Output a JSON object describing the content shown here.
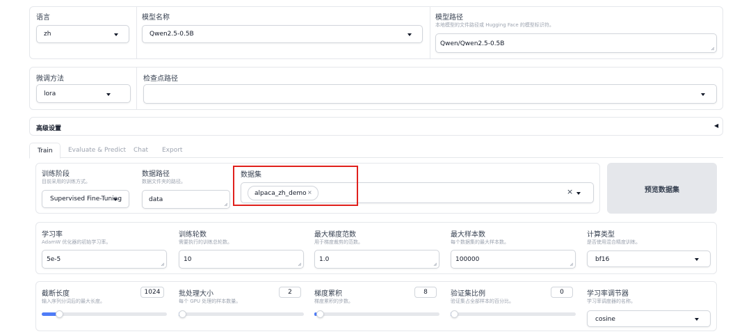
{
  "top": {
    "language": {
      "label": "语言",
      "value": "zh"
    },
    "model_name": {
      "label": "模型名称",
      "value": "Qwen2.5-0.5B"
    },
    "model_path": {
      "label": "模型路径",
      "hint": "本地模型的文件路径或 Hugging Face 的模型标识符。",
      "value": "Qwen/Qwen2.5-0.5B"
    }
  },
  "second": {
    "finetune": {
      "label": "微调方法",
      "value": "lora"
    },
    "checkpoint": {
      "label": "检查点路径",
      "value": ""
    }
  },
  "advanced": {
    "label": "高级设置",
    "arrow": "◀"
  },
  "tabs": [
    "Train",
    "Evaluate & Predict",
    "Chat",
    "Export"
  ],
  "active_tab": "Train",
  "train": {
    "stage": {
      "label": "训练阶段",
      "hint": "目前采用的训练方式。",
      "value": "Supervised Fine-Tuning"
    },
    "data_path": {
      "label": "数据路径",
      "hint": "数据文件夹的路径。",
      "value": "data"
    },
    "dataset": {
      "label": "数据集",
      "chip": "alpaca_zh_demo",
      "chip_close": "×",
      "clear": "×"
    },
    "preview_button": "预览数据集"
  },
  "params_row1": [
    {
      "label": "学习率",
      "hint": "AdamW 优化器的初始学习率。",
      "value": "5e-5"
    },
    {
      "label": "训练轮数",
      "hint": "需要执行的训练总轮数。",
      "value": "10"
    },
    {
      "label": "最大梯度范数",
      "hint": "用于梯度裁剪的范数。",
      "value": "1.0"
    },
    {
      "label": "最大样本数",
      "hint": "每个数据集的最大样本数。",
      "value": "100000"
    }
  ],
  "compute_type": {
    "label": "计算类型",
    "hint": "是否使用混合精度训练。",
    "value": "bf16"
  },
  "params_row2": [
    {
      "label": "截断长度",
      "hint": "输入序列分词后的最大长度。",
      "value": "1024",
      "level": 0.12
    },
    {
      "label": "批处理大小",
      "hint": "每个 GPU 处理的样本数量。",
      "value": "2",
      "level": 0.0
    },
    {
      "label": "梯度累积",
      "hint": "梯度累积的步数。",
      "value": "8",
      "level": 0.02
    },
    {
      "label": "验证集比例",
      "hint": "验证集占全部样本的百分比。",
      "value": "0",
      "level": 0.0
    }
  ],
  "scheduler": {
    "label": "学习率调节器",
    "hint": "学习率调度器的名称。",
    "value": "cosine"
  },
  "colors": {
    "accent": "#4f7cf7",
    "highlight": "#e0201c",
    "border": "#e5e7eb"
  }
}
